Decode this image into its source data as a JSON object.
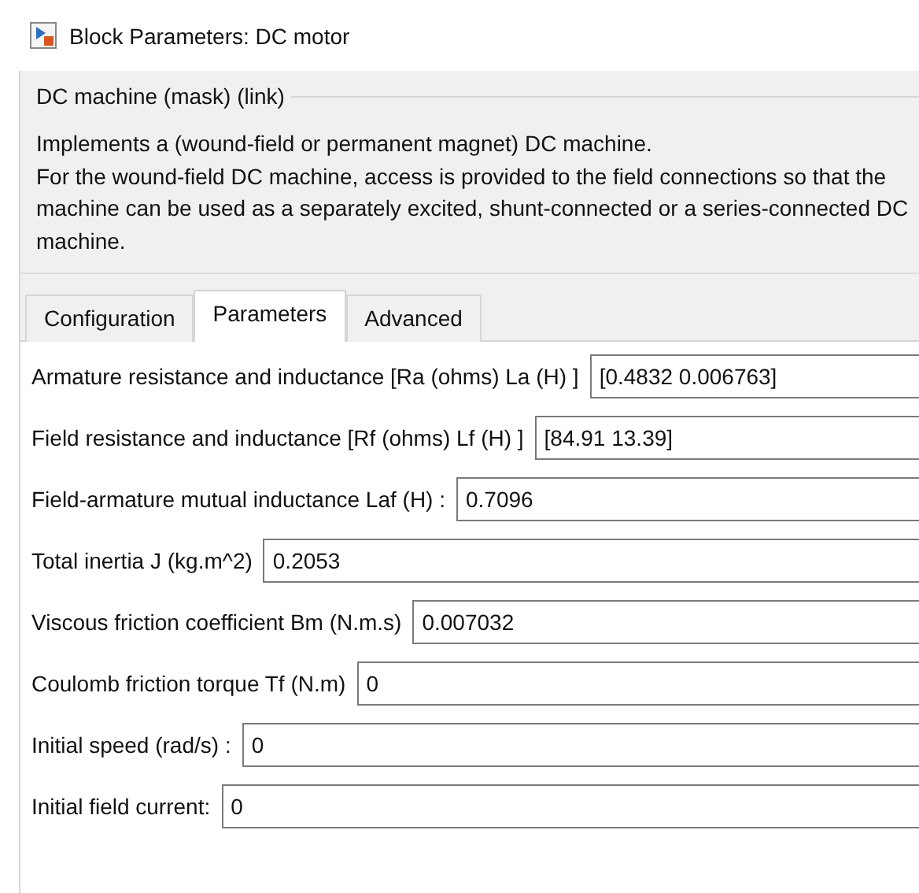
{
  "window": {
    "title": "Block Parameters: DC motor"
  },
  "group": {
    "title": "DC machine (mask) (link)",
    "description": [
      "Implements a (wound-field or permanent magnet) DC machine.",
      "For the wound-field DC machine, access is provided to the field connections so that the machine can be used as a separately excited, shunt-connected or a series-connected  DC machine."
    ]
  },
  "tabs": [
    {
      "label": "Configuration",
      "selected": false
    },
    {
      "label": "Parameters",
      "selected": true
    },
    {
      "label": "Advanced",
      "selected": false
    }
  ],
  "parameters": [
    {
      "label": "Armature resistance and inductance [Ra (ohms) La (H) ]",
      "value": "[0.4832 0.006763]"
    },
    {
      "label": "Field resistance and inductance [Rf (ohms) Lf (H) ]",
      "value": "[84.91 13.39]"
    },
    {
      "label": "Field-armature mutual inductance Laf (H) :",
      "value": "0.7096"
    },
    {
      "label": "Total inertia J (kg.m^2)",
      "value": "0.2053"
    },
    {
      "label": "Viscous friction coefficient Bm (N.m.s)",
      "value": "0.007032"
    },
    {
      "label": "Coulomb friction torque Tf (N.m)",
      "value": "0"
    },
    {
      "label": "Initial speed (rad/s) :",
      "value": "0"
    },
    {
      "label": "Initial field current:",
      "value": "0"
    }
  ]
}
